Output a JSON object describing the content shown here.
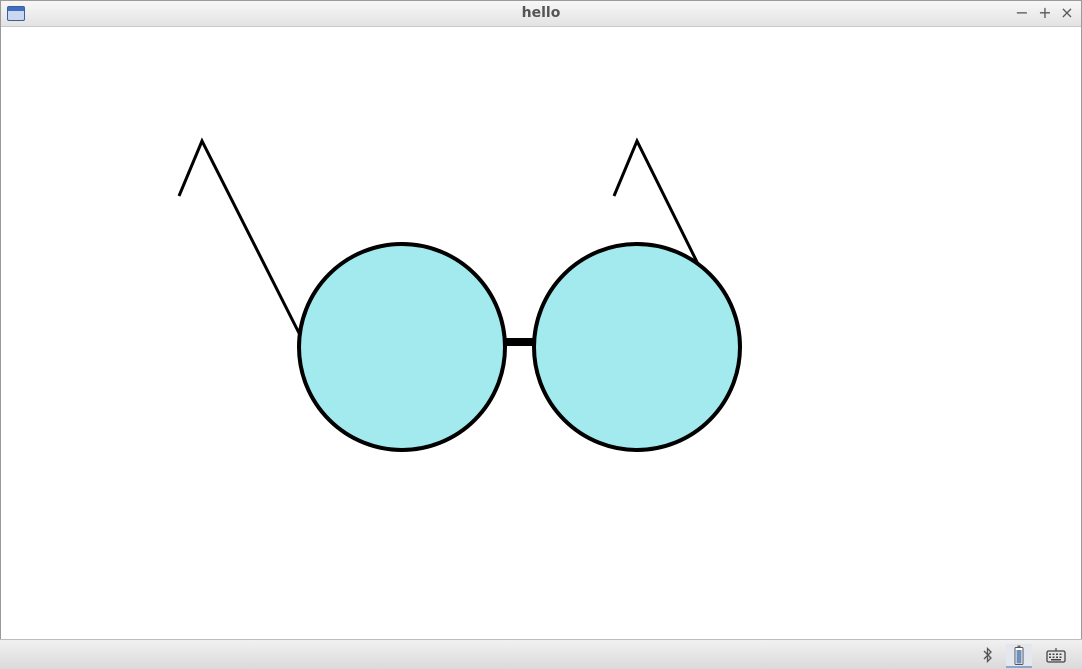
{
  "window": {
    "title": "hello",
    "app_icon": "window-icon",
    "controls": {
      "minimize_label": "−",
      "maximize_label": "+",
      "close_label": "×"
    }
  },
  "drawing": {
    "lens_fill": "#a2eaee",
    "stroke_color": "#000000",
    "bridge_color": "#000000"
  },
  "taskbar": {
    "tray_icons": [
      "bluetooth-icon",
      "battery-icon",
      "keyboard-icon"
    ]
  }
}
